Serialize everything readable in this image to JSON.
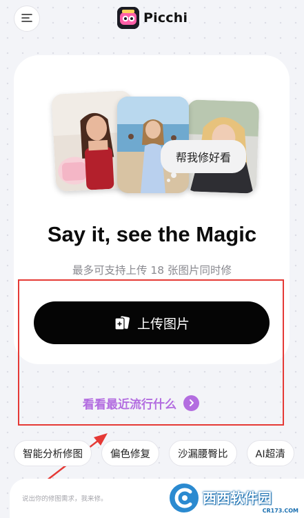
{
  "header": {
    "app_name": "Picchi"
  },
  "hero": {
    "bubble_text": "帮我修好看",
    "headline": "Say it, see the Magic",
    "subtitle": "最多可支持上传 18 张图片同时修",
    "upload_label": "上传图片",
    "trending_label": "看看最近流行什么"
  },
  "chips": [
    {
      "label": "智能分析修图"
    },
    {
      "label": "偏色修复"
    },
    {
      "label": "沙漏腰臀比"
    },
    {
      "label": "AI超清"
    }
  ],
  "input": {
    "placeholder": "说出你的修图需求，我来修。"
  },
  "watermark": {
    "text": "西西软件园",
    "url": "CR173.COM"
  },
  "colors": {
    "accent": "#b36de0",
    "button": "#050505",
    "annotation": "#e53935"
  }
}
